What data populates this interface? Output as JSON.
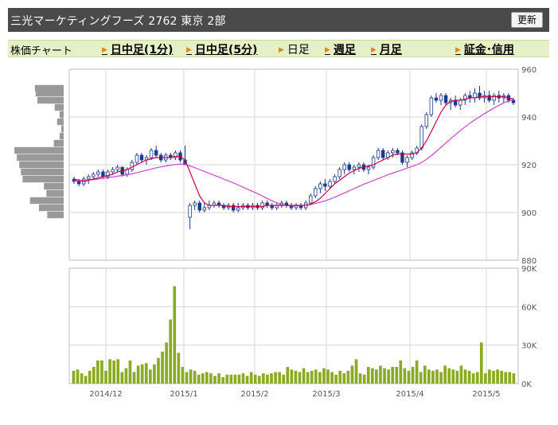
{
  "header": {
    "title": "三光マーケティングフーズ 2762 東京 2部",
    "refresh_label": "更新"
  },
  "tabs": {
    "label": "株価チャート",
    "items": [
      {
        "label": "日中足(1分)",
        "link": true
      },
      {
        "label": "日中足(5分)",
        "link": true
      },
      {
        "label": "日足",
        "link": false
      },
      {
        "label": "週足",
        "link": true
      },
      {
        "label": "月足",
        "link": true
      },
      {
        "label": "証金･信用",
        "link": true
      }
    ]
  },
  "chart_data": [
    {
      "type": "candlestick",
      "title": "",
      "ylim": [
        880,
        960
      ],
      "yticks": [
        "960",
        "940",
        "920",
        "900",
        "880"
      ],
      "grid": true,
      "colors": {
        "up": "#ffffff",
        "down": "#1a3a8a",
        "ma_short": "#cc0044",
        "ma_long": "#cc44cc"
      },
      "ohlc": [
        [
          914,
          915,
          912,
          913
        ],
        [
          913,
          914,
          911,
          912
        ],
        [
          912,
          915,
          911,
          914
        ],
        [
          914,
          916,
          912,
          915
        ],
        [
          915,
          917,
          914,
          916
        ],
        [
          916,
          918,
          915,
          917
        ],
        [
          917,
          918,
          914,
          915
        ],
        [
          915,
          918,
          914,
          917
        ],
        [
          917,
          919,
          916,
          918
        ],
        [
          918,
          920,
          917,
          919
        ],
        [
          919,
          919,
          915,
          916
        ],
        [
          916,
          919,
          915,
          918
        ],
        [
          918,
          922,
          917,
          921
        ],
        [
          921,
          925,
          920,
          924
        ],
        [
          924,
          925,
          921,
          922
        ],
        [
          922,
          924,
          920,
          923
        ],
        [
          923,
          927,
          922,
          926
        ],
        [
          926,
          928,
          923,
          924
        ],
        [
          924,
          925,
          921,
          922
        ],
        [
          922,
          925,
          921,
          924
        ],
        [
          924,
          925,
          922,
          923
        ],
        [
          923,
          926,
          922,
          925
        ],
        [
          925,
          926,
          921,
          922
        ],
        [
          922,
          928,
          920,
          920
        ],
        [
          898,
          904,
          893,
          903
        ],
        [
          903,
          905,
          901,
          904
        ],
        [
          904,
          905,
          900,
          901
        ],
        [
          901,
          904,
          900,
          902
        ],
        [
          902,
          905,
          901,
          903
        ],
        [
          903,
          905,
          902,
          904
        ],
        [
          904,
          905,
          902,
          903
        ],
        [
          903,
          904,
          901,
          902
        ],
        [
          902,
          904,
          901,
          903
        ],
        [
          903,
          904,
          900,
          901
        ],
        [
          901,
          904,
          900,
          902
        ],
        [
          902,
          904,
          901,
          903
        ],
        [
          903,
          904,
          901,
          902
        ],
        [
          902,
          904,
          901,
          903
        ],
        [
          903,
          904,
          901,
          902
        ],
        [
          902,
          905,
          901,
          904
        ],
        [
          904,
          905,
          902,
          903
        ],
        [
          903,
          904,
          901,
          902
        ],
        [
          902,
          904,
          901,
          903
        ],
        [
          903,
          905,
          902,
          904
        ],
        [
          904,
          905,
          902,
          903
        ],
        [
          903,
          904,
          901,
          902
        ],
        [
          902,
          904,
          901,
          903
        ],
        [
          903,
          904,
          901,
          902
        ],
        [
          902,
          905,
          901,
          904
        ],
        [
          904,
          908,
          903,
          907
        ],
        [
          907,
          911,
          906,
          910
        ],
        [
          910,
          913,
          908,
          912
        ],
        [
          912,
          914,
          909,
          911
        ],
        [
          911,
          914,
          910,
          913
        ],
        [
          913,
          916,
          912,
          915
        ],
        [
          915,
          919,
          914,
          918
        ],
        [
          918,
          921,
          916,
          920
        ],
        [
          920,
          921,
          917,
          918
        ],
        [
          918,
          920,
          916,
          919
        ],
        [
          919,
          921,
          917,
          920
        ],
        [
          920,
          921,
          917,
          918
        ],
        [
          918,
          920,
          916,
          919
        ],
        [
          919,
          924,
          918,
          923
        ],
        [
          923,
          927,
          922,
          926
        ],
        [
          926,
          927,
          922,
          923
        ],
        [
          923,
          926,
          922,
          925
        ],
        [
          925,
          927,
          923,
          926
        ],
        [
          926,
          927,
          924,
          925
        ],
        [
          925,
          926,
          920,
          921
        ],
        [
          921,
          924,
          919,
          923
        ],
        [
          923,
          926,
          922,
          925
        ],
        [
          925,
          928,
          924,
          927
        ],
        [
          927,
          937,
          926,
          936
        ],
        [
          936,
          942,
          935,
          941
        ],
        [
          941,
          949,
          940,
          948
        ],
        [
          948,
          950,
          946,
          947
        ],
        [
          947,
          950,
          945,
          949
        ],
        [
          949,
          950,
          945,
          946
        ],
        [
          946,
          948,
          943,
          947
        ],
        [
          947,
          949,
          944,
          945
        ],
        [
          945,
          948,
          943,
          947
        ],
        [
          947,
          950,
          945,
          949
        ],
        [
          949,
          951,
          946,
          948
        ],
        [
          948,
          952,
          946,
          950
        ],
        [
          950,
          953,
          947,
          948
        ],
        [
          948,
          951,
          946,
          949
        ],
        [
          949,
          951,
          946,
          947
        ],
        [
          947,
          950,
          945,
          949
        ],
        [
          949,
          951,
          946,
          948
        ],
        [
          948,
          950,
          946,
          949
        ],
        [
          949,
          950,
          946,
          947
        ],
        [
          947,
          948,
          945,
          946
        ]
      ],
      "ma_short": [
        914,
        913.5,
        913,
        913.5,
        914,
        914.5,
        915,
        915.5,
        916,
        917,
        917.5,
        918,
        919,
        920,
        921,
        922,
        922.5,
        923,
        923,
        923,
        923,
        923.5,
        923.5,
        922,
        917,
        912,
        907,
        904,
        903,
        903,
        903,
        903,
        902.5,
        902.5,
        902.5,
        902.5,
        902.5,
        902.5,
        902.5,
        902.5,
        903,
        903,
        903,
        903,
        903,
        903,
        903,
        903,
        903,
        903.5,
        904.5,
        906,
        908,
        910,
        912,
        913.5,
        915,
        916.5,
        917.5,
        918.5,
        919,
        919.5,
        920,
        921,
        922,
        923,
        924,
        924.5,
        924.5,
        924.5,
        924.5,
        925,
        927,
        930,
        934,
        938,
        942,
        945,
        946.5,
        947,
        947,
        947.5,
        948,
        948,
        948.5,
        948.5,
        948.5,
        948.5,
        948.5,
        948.5,
        948,
        947.5
      ],
      "ma_long": [
        913,
        913.2,
        913.4,
        913.6,
        913.8,
        914,
        914.3,
        914.6,
        914.9,
        915.2,
        915.5,
        915.8,
        916.2,
        916.7,
        917.2,
        917.7,
        918.2,
        918.7,
        919.1,
        919.5,
        919.8,
        920.1,
        920.3,
        920.3,
        919.5,
        918.8,
        918,
        917.2,
        916.4,
        915.6,
        914.8,
        914,
        913.2,
        912.4,
        911.5,
        910.6,
        909.7,
        908.8,
        907.9,
        906.9,
        905.9,
        904.9,
        904,
        903.4,
        903,
        902.8,
        902.8,
        902.9,
        903.1,
        903.4,
        903.8,
        904.3,
        904.9,
        905.6,
        906.4,
        907.3,
        908.2,
        909.1,
        910,
        910.9,
        911.8,
        912.6,
        913.4,
        914.2,
        915,
        915.8,
        916.5,
        917.2,
        917.9,
        918.6,
        919.3,
        920,
        921,
        922.3,
        923.8,
        925.5,
        927.3,
        929.1,
        930.9,
        932.6,
        934.3,
        935.9,
        937.4,
        938.8,
        940.1,
        941.4,
        942.6,
        943.8,
        944.9,
        945.9,
        946.7,
        947.2
      ]
    },
    {
      "type": "bar",
      "title": "",
      "ylim": [
        0,
        90000
      ],
      "yticks": [
        "90K",
        "60K",
        "30K",
        "0K"
      ],
      "xticks": [
        "2014/12",
        "2015/1",
        "2015/2",
        "2015/3",
        "2015/4",
        "2015/5"
      ],
      "grid": true,
      "colors": {
        "bar": "#8aaa22"
      },
      "values": [
        10000,
        11000,
        8000,
        6000,
        10000,
        13000,
        18000,
        18000,
        10000,
        19000,
        18000,
        19000,
        9000,
        12000,
        18000,
        9000,
        14000,
        15000,
        16000,
        11000,
        15000,
        20000,
        25000,
        32000,
        50000,
        76000,
        24000,
        13000,
        9000,
        11000,
        10000,
        7000,
        8000,
        9000,
        8000,
        6000,
        8000,
        5000,
        7000,
        7000,
        7000,
        7000,
        8000,
        6000,
        9000,
        7000,
        6000,
        8000,
        7000,
        8000,
        9000,
        9000,
        7000,
        13000,
        11000,
        10000,
        9000,
        12000,
        9000,
        10000,
        11000,
        9000,
        12000,
        11000,
        9000,
        7000,
        10000,
        8000,
        10000,
        14000,
        19000,
        8000,
        7000,
        13000,
        12000,
        11000,
        14000,
        12000,
        11000,
        13000,
        13000,
        18000,
        12000,
        10000,
        13000,
        18000,
        9000,
        14000,
        11000,
        10000,
        11000,
        9000,
        14000,
        12000,
        11000,
        10000,
        14000,
        11000,
        10000,
        8000,
        9000,
        32000,
        8000,
        11000,
        10000,
        11000,
        10000,
        9000,
        9000,
        8000
      ]
    }
  ],
  "side_histogram": {
    "type": "bar",
    "orientation": "horizontal",
    "colors": {
      "bar": "#999999"
    },
    "levels": [
      952,
      950,
      947,
      944,
      941,
      938,
      935,
      932,
      929,
      926,
      923,
      920,
      917,
      914,
      911,
      908,
      905,
      902,
      899
    ],
    "values": [
      35,
      34,
      32,
      11,
      5,
      8,
      3,
      5,
      12,
      60,
      57,
      54,
      52,
      50,
      24,
      21,
      41,
      30,
      20
    ]
  }
}
